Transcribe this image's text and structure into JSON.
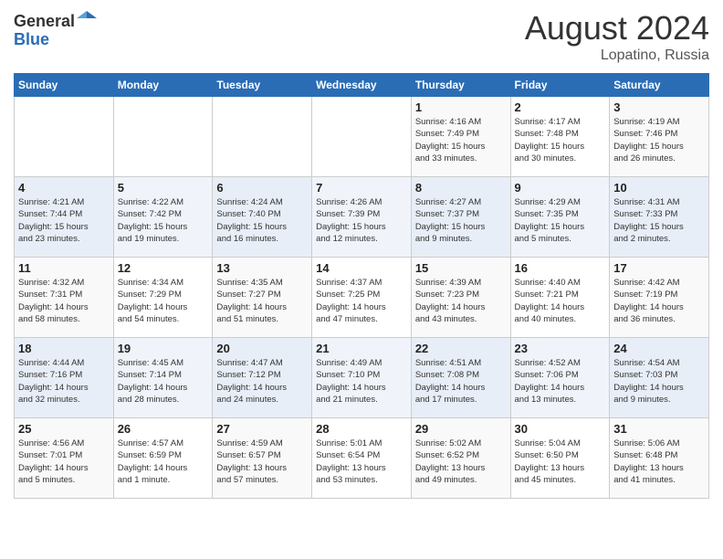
{
  "header": {
    "logo_general": "General",
    "logo_blue": "Blue",
    "month": "August 2024",
    "location": "Lopatino, Russia"
  },
  "days_of_week": [
    "Sunday",
    "Monday",
    "Tuesday",
    "Wednesday",
    "Thursday",
    "Friday",
    "Saturday"
  ],
  "weeks": [
    [
      {
        "num": "",
        "info": ""
      },
      {
        "num": "",
        "info": ""
      },
      {
        "num": "",
        "info": ""
      },
      {
        "num": "",
        "info": ""
      },
      {
        "num": "1",
        "info": "Sunrise: 4:16 AM\nSunset: 7:49 PM\nDaylight: 15 hours\nand 33 minutes."
      },
      {
        "num": "2",
        "info": "Sunrise: 4:17 AM\nSunset: 7:48 PM\nDaylight: 15 hours\nand 30 minutes."
      },
      {
        "num": "3",
        "info": "Sunrise: 4:19 AM\nSunset: 7:46 PM\nDaylight: 15 hours\nand 26 minutes."
      }
    ],
    [
      {
        "num": "4",
        "info": "Sunrise: 4:21 AM\nSunset: 7:44 PM\nDaylight: 15 hours\nand 23 minutes."
      },
      {
        "num": "5",
        "info": "Sunrise: 4:22 AM\nSunset: 7:42 PM\nDaylight: 15 hours\nand 19 minutes."
      },
      {
        "num": "6",
        "info": "Sunrise: 4:24 AM\nSunset: 7:40 PM\nDaylight: 15 hours\nand 16 minutes."
      },
      {
        "num": "7",
        "info": "Sunrise: 4:26 AM\nSunset: 7:39 PM\nDaylight: 15 hours\nand 12 minutes."
      },
      {
        "num": "8",
        "info": "Sunrise: 4:27 AM\nSunset: 7:37 PM\nDaylight: 15 hours\nand 9 minutes."
      },
      {
        "num": "9",
        "info": "Sunrise: 4:29 AM\nSunset: 7:35 PM\nDaylight: 15 hours\nand 5 minutes."
      },
      {
        "num": "10",
        "info": "Sunrise: 4:31 AM\nSunset: 7:33 PM\nDaylight: 15 hours\nand 2 minutes."
      }
    ],
    [
      {
        "num": "11",
        "info": "Sunrise: 4:32 AM\nSunset: 7:31 PM\nDaylight: 14 hours\nand 58 minutes."
      },
      {
        "num": "12",
        "info": "Sunrise: 4:34 AM\nSunset: 7:29 PM\nDaylight: 14 hours\nand 54 minutes."
      },
      {
        "num": "13",
        "info": "Sunrise: 4:35 AM\nSunset: 7:27 PM\nDaylight: 14 hours\nand 51 minutes."
      },
      {
        "num": "14",
        "info": "Sunrise: 4:37 AM\nSunset: 7:25 PM\nDaylight: 14 hours\nand 47 minutes."
      },
      {
        "num": "15",
        "info": "Sunrise: 4:39 AM\nSunset: 7:23 PM\nDaylight: 14 hours\nand 43 minutes."
      },
      {
        "num": "16",
        "info": "Sunrise: 4:40 AM\nSunset: 7:21 PM\nDaylight: 14 hours\nand 40 minutes."
      },
      {
        "num": "17",
        "info": "Sunrise: 4:42 AM\nSunset: 7:19 PM\nDaylight: 14 hours\nand 36 minutes."
      }
    ],
    [
      {
        "num": "18",
        "info": "Sunrise: 4:44 AM\nSunset: 7:16 PM\nDaylight: 14 hours\nand 32 minutes."
      },
      {
        "num": "19",
        "info": "Sunrise: 4:45 AM\nSunset: 7:14 PM\nDaylight: 14 hours\nand 28 minutes."
      },
      {
        "num": "20",
        "info": "Sunrise: 4:47 AM\nSunset: 7:12 PM\nDaylight: 14 hours\nand 24 minutes."
      },
      {
        "num": "21",
        "info": "Sunrise: 4:49 AM\nSunset: 7:10 PM\nDaylight: 14 hours\nand 21 minutes."
      },
      {
        "num": "22",
        "info": "Sunrise: 4:51 AM\nSunset: 7:08 PM\nDaylight: 14 hours\nand 17 minutes."
      },
      {
        "num": "23",
        "info": "Sunrise: 4:52 AM\nSunset: 7:06 PM\nDaylight: 14 hours\nand 13 minutes."
      },
      {
        "num": "24",
        "info": "Sunrise: 4:54 AM\nSunset: 7:03 PM\nDaylight: 14 hours\nand 9 minutes."
      }
    ],
    [
      {
        "num": "25",
        "info": "Sunrise: 4:56 AM\nSunset: 7:01 PM\nDaylight: 14 hours\nand 5 minutes."
      },
      {
        "num": "26",
        "info": "Sunrise: 4:57 AM\nSunset: 6:59 PM\nDaylight: 14 hours\nand 1 minute."
      },
      {
        "num": "27",
        "info": "Sunrise: 4:59 AM\nSunset: 6:57 PM\nDaylight: 13 hours\nand 57 minutes."
      },
      {
        "num": "28",
        "info": "Sunrise: 5:01 AM\nSunset: 6:54 PM\nDaylight: 13 hours\nand 53 minutes."
      },
      {
        "num": "29",
        "info": "Sunrise: 5:02 AM\nSunset: 6:52 PM\nDaylight: 13 hours\nand 49 minutes."
      },
      {
        "num": "30",
        "info": "Sunrise: 5:04 AM\nSunset: 6:50 PM\nDaylight: 13 hours\nand 45 minutes."
      },
      {
        "num": "31",
        "info": "Sunrise: 5:06 AM\nSunset: 6:48 PM\nDaylight: 13 hours\nand 41 minutes."
      }
    ]
  ]
}
